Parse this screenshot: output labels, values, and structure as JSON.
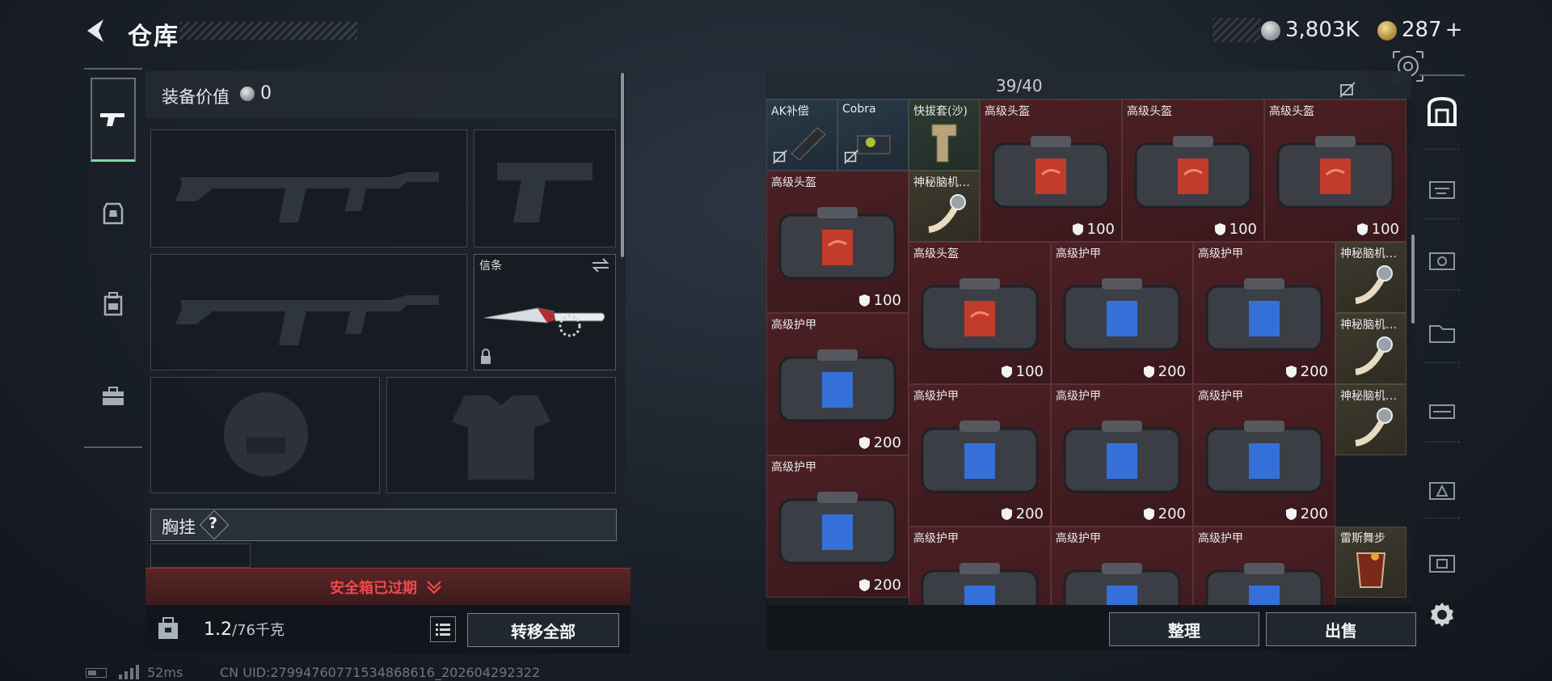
{
  "header": {
    "title": "仓库",
    "silver_amount": "3,803K",
    "gold_amount": "287",
    "gold_plus": "+"
  },
  "equipment": {
    "value_label": "装备价值",
    "value_amount": "0",
    "secure_slot_label": "信条",
    "chest_rig_label": "胸挂",
    "chest_rig_help": "?",
    "safe_box_expired": "安全箱已过期",
    "weight_value": "1.2",
    "weight_capacity": "/76千克",
    "transfer_all": "转移全部"
  },
  "stash": {
    "capacity": "39/40",
    "sort_button": "整理",
    "sell_button": "出售",
    "items": [
      {
        "label": "AK补偿",
        "durability": ""
      },
      {
        "label": "Cobra",
        "durability": ""
      },
      {
        "label": "快拔套(沙)",
        "durability": ""
      },
      {
        "label": "高级头盔",
        "durability": "100"
      },
      {
        "label": "高级头盔",
        "durability": "100"
      },
      {
        "label": "高级头盔",
        "durability": "100"
      },
      {
        "label": "高级头盔",
        "durability": "100"
      },
      {
        "label": "神秘脑机…",
        "durability": ""
      },
      {
        "label": "高级头盔",
        "durability": "100"
      },
      {
        "label": "高级护甲",
        "durability": "200"
      },
      {
        "label": "高级护甲",
        "durability": "200"
      },
      {
        "label": "神秘脑机…",
        "durability": ""
      },
      {
        "label": "高级护甲",
        "durability": "200"
      },
      {
        "label": "神秘脑机…",
        "durability": ""
      },
      {
        "label": "高级护甲",
        "durability": "200"
      },
      {
        "label": "高级护甲",
        "durability": "200"
      },
      {
        "label": "高级护甲",
        "durability": "200"
      },
      {
        "label": "神秘脑机…",
        "durability": ""
      },
      {
        "label": "高级护甲",
        "durability": "200"
      },
      {
        "label": "高级护甲",
        "durability": ""
      },
      {
        "label": "高级护甲",
        "durability": ""
      },
      {
        "label": "高级护甲",
        "durability": ""
      },
      {
        "label": "雷斯舞步",
        "durability": ""
      }
    ]
  },
  "status_bar": {
    "ping": "52ms",
    "uid": "CN UID:2799476077153486861​6_202604292322"
  },
  "colors": {
    "expired_red": "#f2484d",
    "selected_tab_green": "#7fd9a3",
    "helmet_cell": "#4c2024",
    "attachment_cell": "#2a3a48"
  },
  "icons": {
    "back": "back-arrow-icon",
    "weapon_tab": "pistol-icon",
    "armor_tab": "armor-icon",
    "backpack_tab": "backpack-icon",
    "toolbox_tab": "toolbox-icon",
    "settings": "gear-icon"
  }
}
